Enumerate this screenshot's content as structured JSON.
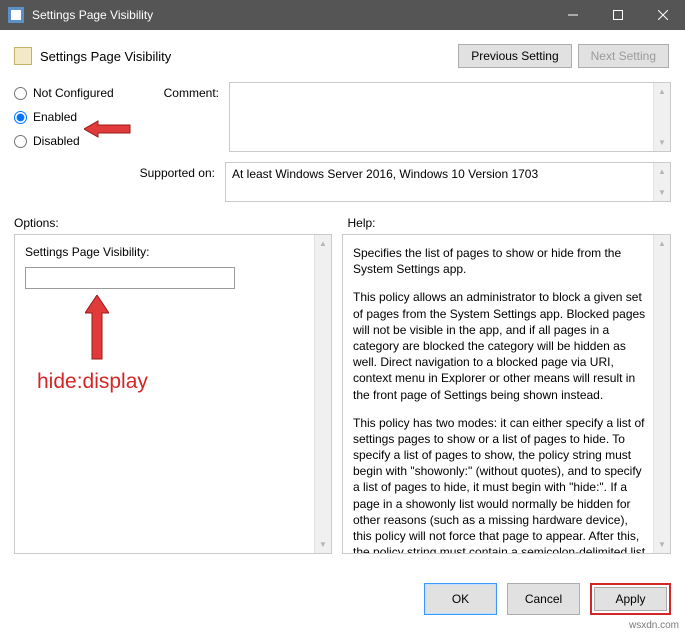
{
  "window": {
    "title": "Settings Page Visibility"
  },
  "header": {
    "title": "Settings Page Visibility",
    "prev_label": "Previous Setting",
    "next_label": "Next Setting"
  },
  "radios": {
    "not_configured": "Not Configured",
    "enabled": "Enabled",
    "disabled": "Disabled",
    "selected": "enabled"
  },
  "labels": {
    "comment": "Comment:",
    "supported_on": "Supported on:",
    "options": "Options:",
    "help": "Help:"
  },
  "supported_text": "At least Windows Server 2016, Windows 10 Version 1703",
  "options_panel": {
    "field_label": "Settings Page Visibility:",
    "field_value": "",
    "hint": "hide:display"
  },
  "help_text": {
    "p1": "Specifies the list of pages to show or hide from the System Settings app.",
    "p2": "This policy allows an administrator to block a given set of pages from the System Settings app. Blocked pages will not be visible in the app, and if all pages in a category are blocked the category will be hidden as well. Direct navigation to a blocked page via URI, context menu in Explorer or other means will result in the front page of Settings being shown instead.",
    "p3": "This policy has two modes: it can either specify a list of settings pages to show or a list of pages to hide. To specify a list of pages to show, the policy string must begin with \"showonly:\" (without quotes), and to specify a list of pages to hide, it must begin with \"hide:\". If a page in a showonly list would normally be hidden for other reasons (such as a missing hardware device), this policy will not force that page to appear. After this, the policy string must contain a semicolon-delimited list of settings page identifiers. The identifier for any given settings page is the published URI for that page, minus the \"ms-settings:\" protocol part."
  },
  "footer": {
    "ok": "OK",
    "cancel": "Cancel",
    "apply": "Apply"
  },
  "watermark": "wsxdn.com"
}
